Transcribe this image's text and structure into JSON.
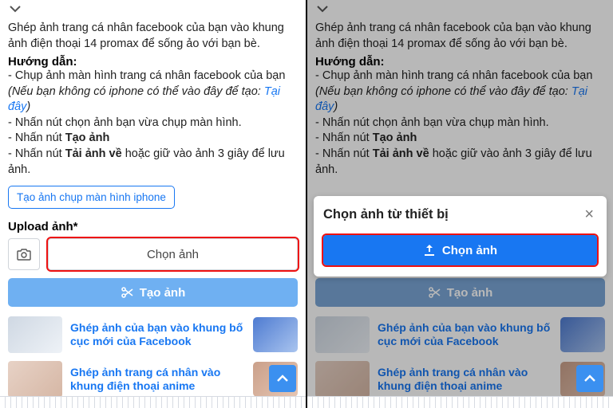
{
  "desc": "Ghép ảnh trang cá nhân facebook của bạn vào khung ảnh điện thoại 14 promax để sống ảo với bạn bè.",
  "instr_heading": "Hướng dẫn:",
  "instr_l1a": "- Chụp ảnh màn hình trang cá nhân facebook của bạn ",
  "instr_l1b": "(Nếu bạn không có iphone có thể vào đây để tạo: ",
  "instr_link": "Tại đây",
  "instr_l1c": ")",
  "instr_l2": "- Nhấn nút chọn ảnh bạn vừa chụp màn hình.",
  "instr_l3a": "- Nhấn nút ",
  "instr_l3b": "Tạo ảnh",
  "instr_l4a": "- Nhấn nút ",
  "instr_l4b": "Tải ảnh về",
  "instr_l4c": " hoặc giữ vào ảnh 3 giây để lưu ảnh.",
  "screenshot_tool_btn": "Tạo ảnh chụp màn hình iphone",
  "upload_label": "Upload ảnh*",
  "choose_btn": "Chọn ảnh",
  "create_btn": "Tạo ảnh",
  "card1": "Ghép ảnh của bạn vào khung bố cục mới của Facebook",
  "card2": "Ghép ảnh trang cá nhân vào khung điện thoại anime",
  "modal_title": "Chọn ảnh từ thiết bị",
  "modal_btn": "Chọn ảnh"
}
